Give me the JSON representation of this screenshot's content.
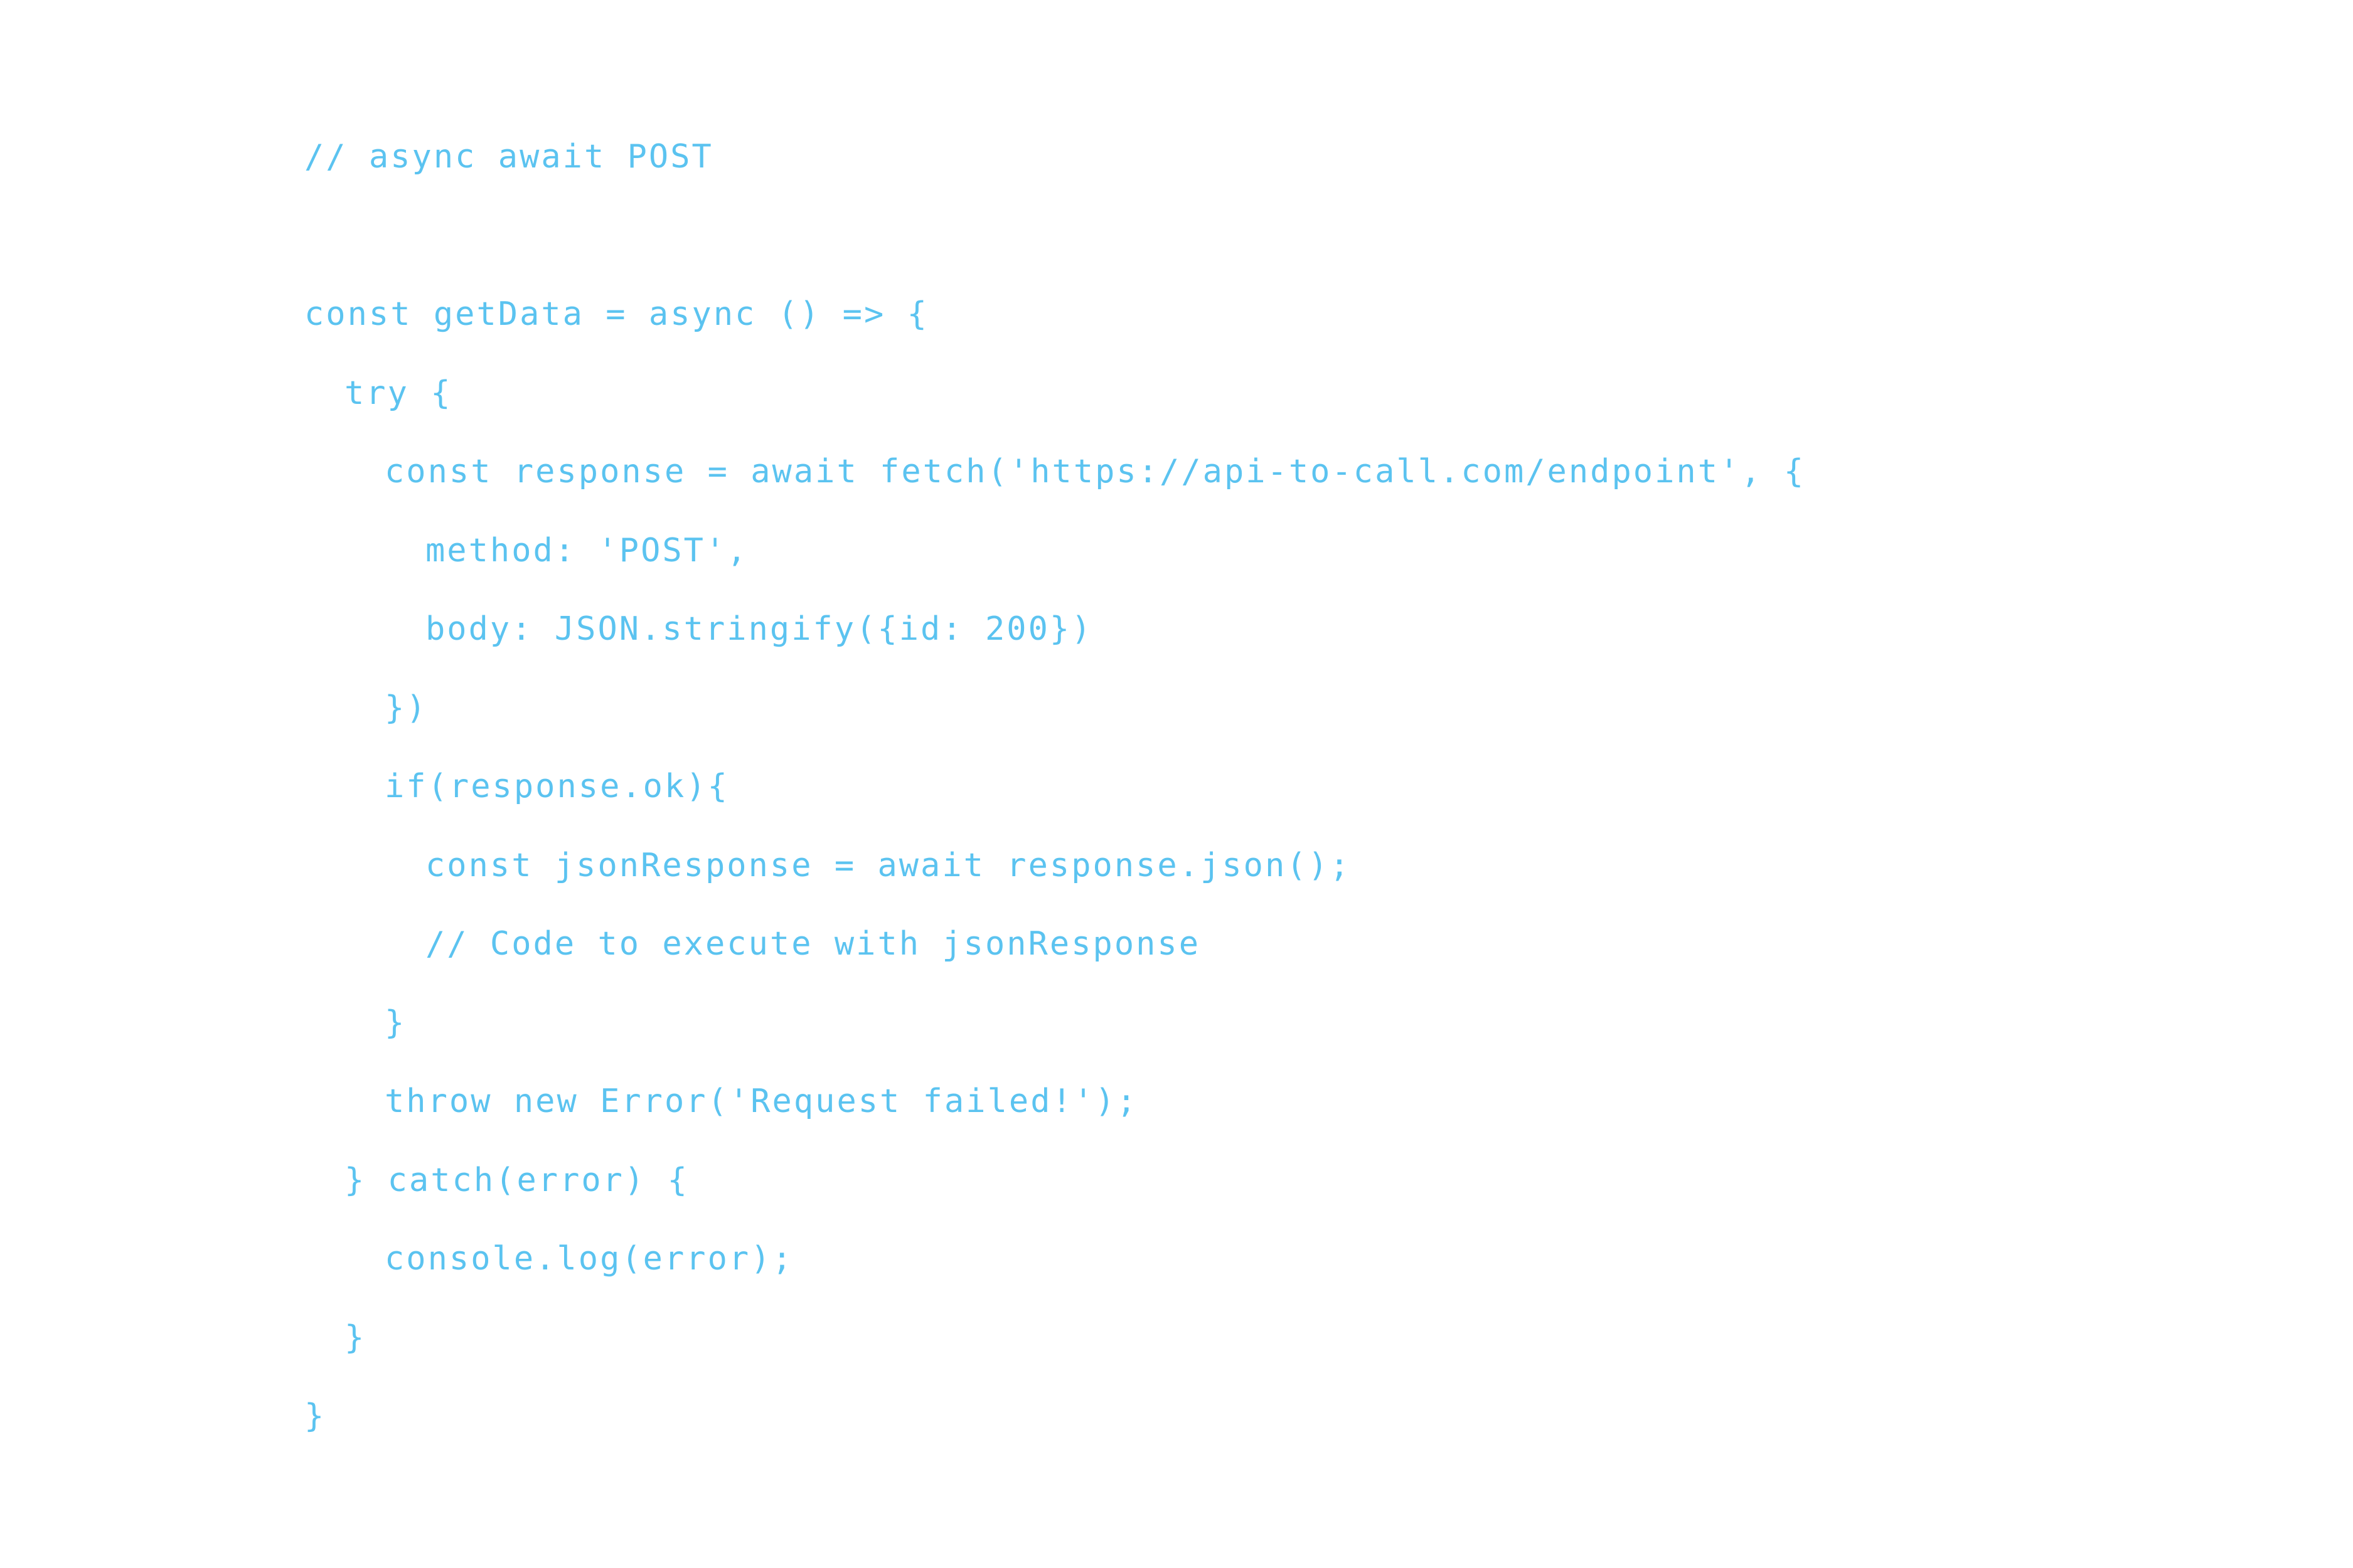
{
  "code": {
    "lines": [
      {
        "indent": 0,
        "text": "// async await POST"
      },
      {
        "indent": 0,
        "text": ""
      },
      {
        "indent": 0,
        "text": "const getData = async () => {"
      },
      {
        "indent": 1,
        "text": "try {"
      },
      {
        "indent": 2,
        "text": "const response = await fetch('https://api-to-call.com/endpoint', {"
      },
      {
        "indent": 3,
        "text": "method: 'POST',"
      },
      {
        "indent": 3,
        "text": "body: JSON.stringify({id: 200})"
      },
      {
        "indent": 2,
        "text": "})"
      },
      {
        "indent": 2,
        "text": "if(response.ok){"
      },
      {
        "indent": 3,
        "text": "const jsonResponse = await response.json();"
      },
      {
        "indent": 3,
        "text": "// Code to execute with jsonResponse"
      },
      {
        "indent": 2,
        "text": "}"
      },
      {
        "indent": 2,
        "text": "throw new Error('Request failed!');"
      },
      {
        "indent": 1,
        "text": "} catch(error) {"
      },
      {
        "indent": 2,
        "text": "console.log(error);"
      },
      {
        "indent": 1,
        "text": "}"
      },
      {
        "indent": 0,
        "text": "}"
      }
    ],
    "text_color": "#5bc3f0",
    "background_color": "#ffffff"
  }
}
